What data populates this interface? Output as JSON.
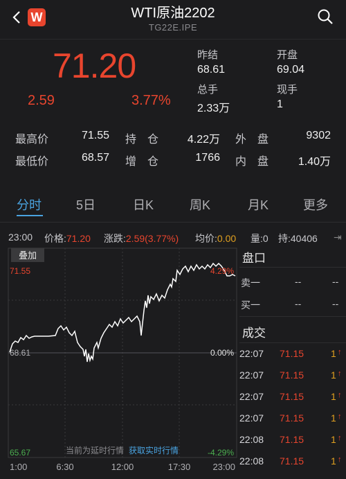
{
  "header": {
    "title": "WTI原油2202",
    "subtitle": "TG22E.IPE",
    "logo_text": "W",
    "back_icon": "chevron-left-icon",
    "search_icon": "search-icon"
  },
  "quote": {
    "price": "71.20",
    "change": "2.59",
    "change_pct": "3.77%",
    "prev_close_label": "昨结",
    "prev_close": "68.61",
    "open_label": "开盘",
    "open": "69.04",
    "volume_label": "总手",
    "volume": "2.33万",
    "current_label": "现手",
    "current": "1"
  },
  "stats": {
    "high_label": "最高价",
    "high": "71.55",
    "low_label": "最低价",
    "low": "68.57",
    "oi_label": "持　仓",
    "oi": "4.22万",
    "oi_chg_label": "增　仓",
    "oi_chg": "1766",
    "outer_label": "外　盘",
    "outer": "9302",
    "inner_label": "内　盘",
    "inner": "1.40万"
  },
  "tabs": [
    "分时",
    "5日",
    "日K",
    "周K",
    "月K",
    "更多"
  ],
  "info_bar": {
    "time": "23:00",
    "price_label": "价格:",
    "price": "71.20",
    "chg_label": "涨跌:",
    "chg": "2.59(3.77%)",
    "avg_label": "均价:",
    "avg": "0.00",
    "vol_label": "量:",
    "vol": "0",
    "oi_label": "持:",
    "oi": "40406"
  },
  "chart": {
    "overlay_button": "叠加",
    "y_high": "71.55",
    "y_mid": "68.61",
    "y_low": "65.67",
    "pct_high": "4.29%",
    "pct_mid": "0.00%",
    "pct_low": "-4.29%",
    "x_labels": [
      "1:00",
      "6:30",
      "12:00",
      "17:30",
      "23:00"
    ],
    "delay_note": "当前为延时行情",
    "realtime_link": "获取实时行情"
  },
  "order_book": {
    "title": "盘口",
    "sell_label": "卖一",
    "buy_label": "买一",
    "dash": "--"
  },
  "trades": {
    "title": "成交",
    "rows": [
      {
        "time": "22:07",
        "price": "71.15",
        "qty": "1"
      },
      {
        "time": "22:07",
        "price": "71.15",
        "qty": "1"
      },
      {
        "time": "22:07",
        "price": "71.15",
        "qty": "1"
      },
      {
        "time": "22:07",
        "price": "71.15",
        "qty": "1"
      },
      {
        "time": "22:08",
        "price": "71.15",
        "qty": "1"
      },
      {
        "time": "22:08",
        "price": "71.15",
        "qty": "1"
      }
    ]
  },
  "colors": {
    "up": "#e8452e",
    "accent": "#4aa3e0",
    "qty": "#e0a020"
  }
}
